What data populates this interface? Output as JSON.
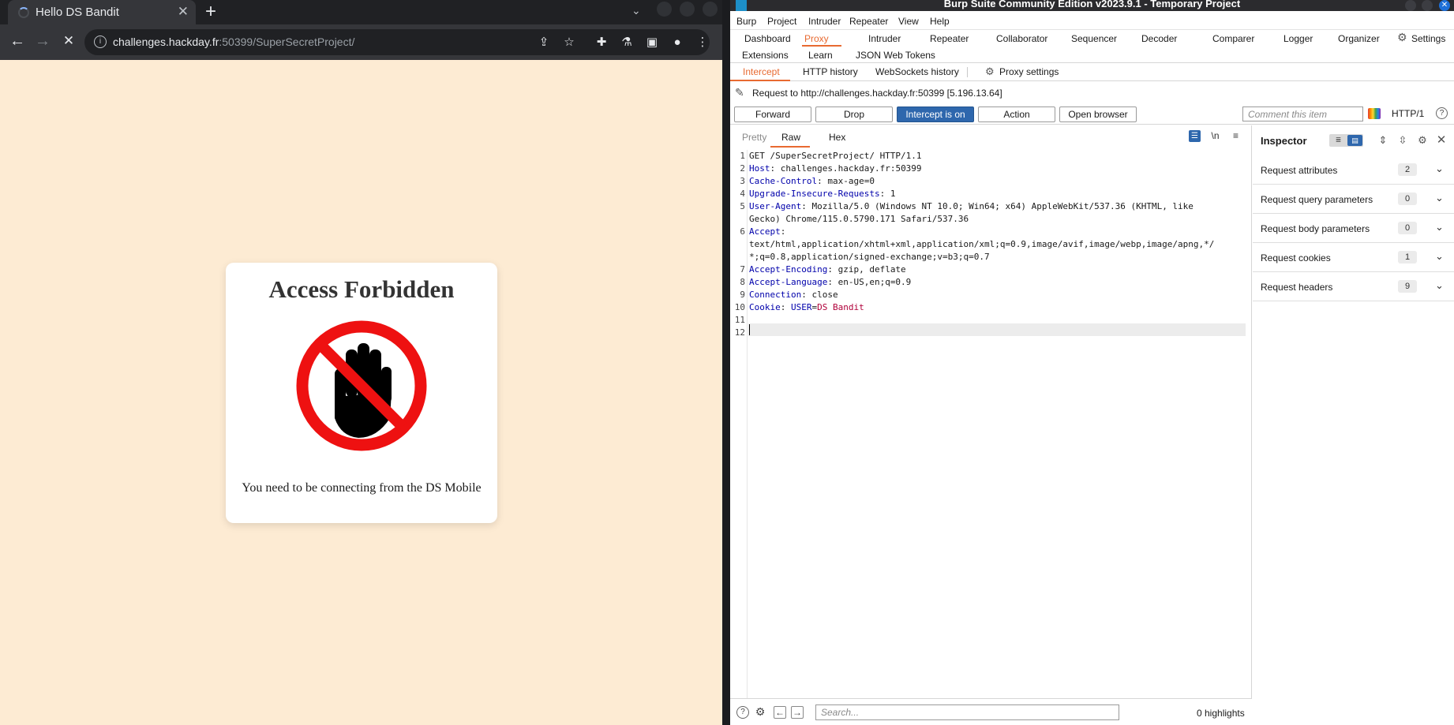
{
  "browser": {
    "tab": {
      "title": "Hello DS Bandit"
    },
    "url": {
      "host": "challenges.hackday.fr",
      "rest": ":50399/SuperSecretProject/"
    },
    "page": {
      "heading": "Access Forbidden",
      "message": "You need to be connecting from the DS Mobile"
    }
  },
  "burp": {
    "window_title": "Burp Suite Community Edition v2023.9.1 - Temporary Project",
    "menu": [
      "Burp",
      "Project",
      "Intruder",
      "Repeater",
      "View",
      "Help"
    ],
    "tabs_row1": [
      "Dashboard",
      "Proxy",
      "Intruder",
      "Repeater",
      "Collaborator",
      "Sequencer",
      "Decoder",
      "Comparer",
      "Logger",
      "Organizer",
      "Settings"
    ],
    "tabs_row2": [
      "Extensions",
      "Learn",
      "JSON Web Tokens"
    ],
    "subtabs": [
      "Intercept",
      "HTTP history",
      "WebSockets history",
      "Proxy settings"
    ],
    "request_info": "Request to http://challenges.hackday.fr:50399  [5.196.13.64]",
    "buttons": {
      "forward": "Forward",
      "drop": "Drop",
      "intercept": "Intercept is on",
      "action": "Action",
      "open_browser": "Open browser"
    },
    "comment_placeholder": "Comment this item",
    "http_version": "HTTP/1",
    "editor_tabs": [
      "Pretty",
      "Raw",
      "Hex"
    ],
    "newline_toggle": "\\n",
    "line_numbers": [
      "1",
      "2",
      "3",
      "4",
      "5",
      "",
      "6",
      "",
      "",
      "7",
      "8",
      "9",
      "10",
      "11",
      "12"
    ],
    "lines": [
      {
        "text": "GET /SuperSecretProject/ HTTP/1.1"
      },
      {
        "name": "Host",
        "value": ": challenges.hackday.fr:50399"
      },
      {
        "name": "Cache-Control",
        "value": ": max-age=0"
      },
      {
        "name": "Upgrade-Insecure-Requests",
        "value": ": 1"
      },
      {
        "name": "User-Agent",
        "value": ": Mozilla/5.0 (Windows NT 10.0; Win64; x64) AppleWebKit/537.36 (KHTML, like"
      },
      {
        "text": "Gecko) Chrome/115.0.5790.171 Safari/537.36"
      },
      {
        "name": "Accept",
        "value": ":"
      },
      {
        "text": "text/html,application/xhtml+xml,application/xml;q=0.9,image/avif,image/webp,image/apng,*/"
      },
      {
        "text": "*;q=0.8,application/signed-exchange;v=b3;q=0.7"
      },
      {
        "name": "Accept-Encoding",
        "value": ": gzip, deflate"
      },
      {
        "name": "Accept-Language",
        "value": ": en-US,en;q=0.9"
      },
      {
        "name": "Connection",
        "value": ": close"
      },
      {
        "name": "Cookie",
        "value": ": ",
        "cookie_name": "USER",
        "cookie_eq": "=",
        "cookie_value": "DS Bandit"
      }
    ],
    "search_placeholder": "Search...",
    "highlights": "0 highlights",
    "inspector": {
      "title": "Inspector",
      "rows": [
        {
          "label": "Request attributes",
          "count": "2"
        },
        {
          "label": "Request query parameters",
          "count": "0"
        },
        {
          "label": "Request body parameters",
          "count": "0"
        },
        {
          "label": "Request cookies",
          "count": "1"
        },
        {
          "label": "Request headers",
          "count": "9"
        }
      ]
    }
  },
  "colors": {
    "accent": "#e86a31",
    "button_on": "#2e67ad",
    "header_name": "#0000ab",
    "cookie_value": "#b0003a",
    "page_bg": "#fdebd3"
  }
}
